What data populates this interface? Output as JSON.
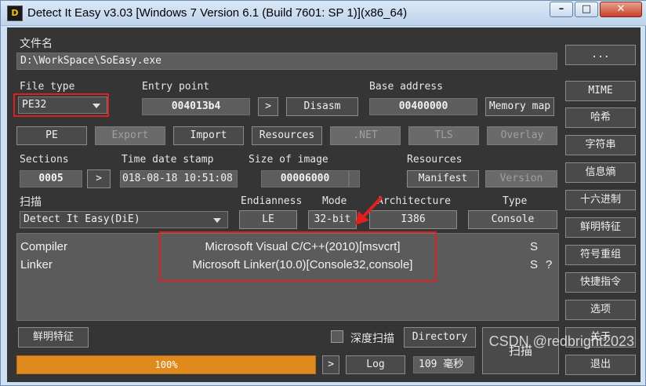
{
  "window": {
    "title": "Detect It Easy v3.03 [Windows 7 Version 6.1 (Build 7601: SP 1)](x86_64)",
    "icon_text": "D"
  },
  "titlebar_buttons": {
    "minimize": "–",
    "maximize": "□",
    "close": "✕"
  },
  "file": {
    "label": "文件名",
    "path": "D:\\WorkSpace\\SoEasy.exe",
    "browse_label": "..."
  },
  "file_type": {
    "label": "File type",
    "value": "PE32"
  },
  "entry_point": {
    "label": "Entry point",
    "value": "004013b4",
    "arrow": ">",
    "disasm": "Disasm"
  },
  "base_address": {
    "label": "Base address",
    "value": "00400000",
    "memory_map": "Memory map"
  },
  "tabs": [
    {
      "label": "PE",
      "enabled": true
    },
    {
      "label": "Export",
      "enabled": false
    },
    {
      "label": "Import",
      "enabled": true
    },
    {
      "label": "Resources",
      "enabled": true
    },
    {
      "label": ".NET",
      "enabled": false
    },
    {
      "label": "TLS",
      "enabled": false
    },
    {
      "label": "Overlay",
      "enabled": false
    }
  ],
  "sections": {
    "label": "Sections",
    "value": "0005",
    "arrow": ">"
  },
  "timestamp": {
    "label": "Time date stamp",
    "value": "018-08-18 10:51:08"
  },
  "size_of_image": {
    "label": "Size of image",
    "value": "00006000"
  },
  "resources": {
    "label": "Resources",
    "manifest": "Manifest",
    "version": "Version"
  },
  "scan": {
    "label": "扫描",
    "engine": "Detect It Easy(DiE)"
  },
  "endianness": {
    "label": "Endianness",
    "value": "LE"
  },
  "mode": {
    "label": "Mode",
    "value": "32-bit"
  },
  "architecture": {
    "label": "Architecture",
    "value": "I386"
  },
  "type": {
    "label": "Type",
    "value": "Console"
  },
  "results": [
    {
      "kind": "Compiler",
      "value": "Microsoft Visual C/C++(2010)[msvcrt]",
      "flag": "S",
      "extra": ""
    },
    {
      "kind": "Linker",
      "value": "Microsoft Linker(10.0)[Console32,console]",
      "flag": "S",
      "extra": "?"
    }
  ],
  "bottom": {
    "signatures_button": "鲜明特征",
    "deep_scan_label": "深度扫描",
    "deep_scan_checked": false,
    "directory_button": "Directory",
    "scan_button": "扫描",
    "progress_percent": 100,
    "progress_text": "100%",
    "progress_arrow": ">",
    "log_button": "Log",
    "elapsed": "109 毫秒"
  },
  "side_buttons": [
    "MIME",
    "哈希",
    "字符串",
    "信息熵",
    "十六进制",
    "鲜明特征",
    "符号重组",
    "快捷指令",
    "选项",
    "关于",
    "退出"
  ],
  "watermark": "CSDN @redbright2023",
  "colors": {
    "background": "#353535",
    "field": "#5d5d5d",
    "progress": "#e08a1e",
    "highlight": "#e02020"
  }
}
